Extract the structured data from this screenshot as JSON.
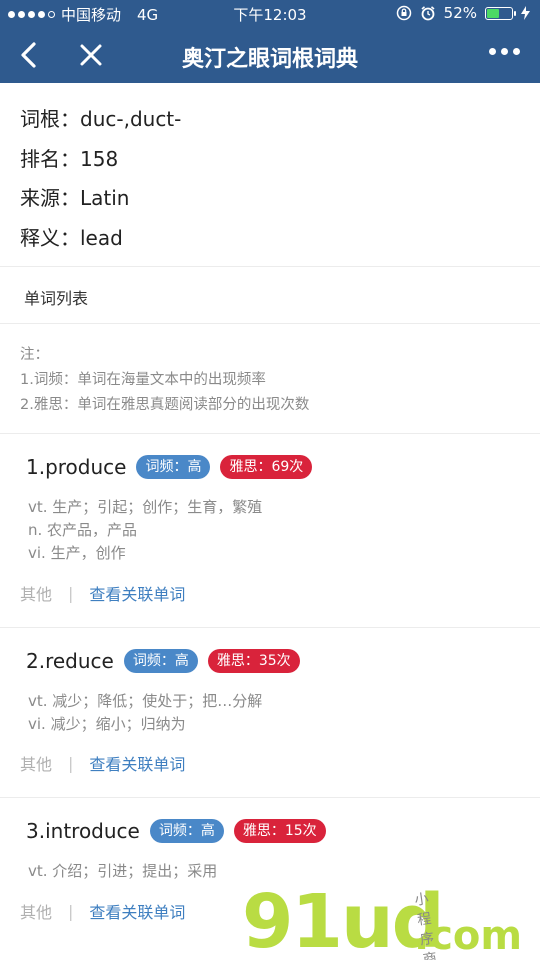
{
  "status_bar": {
    "carrier": "中国移动",
    "network": "4G",
    "time": "下午12:03",
    "battery": "52%",
    "battery_level": 0.52
  },
  "nav": {
    "title": "奥汀之眼词根词典"
  },
  "root_info": [
    {
      "label": "词根：",
      "value": "duc-,duct-"
    },
    {
      "label": "排名：",
      "value": "158"
    },
    {
      "label": "来源：",
      "value": "Latin"
    },
    {
      "label": "释义：",
      "value": "lead"
    }
  ],
  "section_title": "单词列表",
  "notes": {
    "heading": "注：",
    "lines": [
      "1.词频：单词在海量文本中的出现频率",
      "2.雅思：单词在雅思真题阅读部分的出现次数"
    ]
  },
  "words": [
    {
      "name": "1.produce",
      "freq": "词频：高",
      "ielts": "雅思：69次",
      "defs": [
        "vt. 生产；引起；创作；生育，繁殖",
        "n. 农产品，产品",
        "vi. 生产，创作"
      ],
      "other": "其他",
      "sep": "|",
      "link": "查看关联单词"
    },
    {
      "name": "2.reduce",
      "freq": "词频：高",
      "ielts": "雅思：35次",
      "defs": [
        "vt. 减少；降低；使处于；把…分解",
        "vi. 减少；缩小；归纳为"
      ],
      "other": "其他",
      "sep": "|",
      "link": "查看关联单词"
    },
    {
      "name": "3.introduce",
      "freq": "词频：高",
      "ielts": "雅思：15次",
      "defs": [
        "vt. 介绍；引进；提出；采用"
      ],
      "other": "其他",
      "sep": "|",
      "link": "查看关联单词"
    }
  ],
  "watermark": {
    "big": "91ud",
    "com": ".com",
    "small": "小程序商店"
  },
  "colors": {
    "nav_bg": "#2f5a8e",
    "freq_badge": "#4a88c8",
    "ielts_badge": "#d9233b",
    "link": "#3f7fc0"
  }
}
